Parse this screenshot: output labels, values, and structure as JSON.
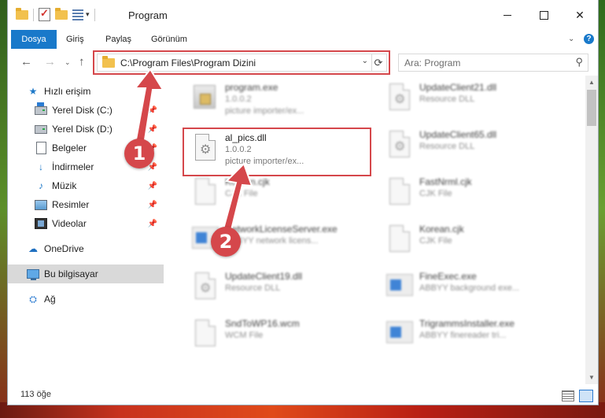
{
  "window": {
    "title": "Program",
    "controls": {
      "minimize": "—",
      "maximize": "☐",
      "close": "✕"
    }
  },
  "ribbon": {
    "tabs": [
      "Dosya",
      "Giriş",
      "Paylaş",
      "Görünüm"
    ],
    "chevron": "⌄",
    "help": "?"
  },
  "navigation": {
    "back": "←",
    "forward": "→",
    "recent": "⌄",
    "up": "↑",
    "address": "C:\\Program Files\\Program Dizini",
    "address_dropdown": "⌄",
    "refresh": "⟳",
    "search_placeholder": "Ara: Program",
    "search_icon": "search-icon"
  },
  "sidebar": {
    "items": [
      {
        "label": "Hızlı erişim",
        "icon": "star-icon",
        "pinned": false
      },
      {
        "label": "Yerel Disk (C:)",
        "icon": "drive-windows-icon",
        "pinned": true
      },
      {
        "label": "Yerel Disk (D:)",
        "icon": "drive-icon",
        "pinned": true
      },
      {
        "label": "Belgeler",
        "icon": "documents-icon",
        "pinned": true
      },
      {
        "label": "İndirmeler",
        "icon": "download-icon",
        "pinned": true
      },
      {
        "label": "Müzik",
        "icon": "music-icon",
        "pinned": true
      },
      {
        "label": "Resimler",
        "icon": "pictures-icon",
        "pinned": true
      },
      {
        "label": "Videolar",
        "icon": "videos-icon",
        "pinned": true
      },
      {
        "label": "OneDrive",
        "icon": "onedrive-icon",
        "pinned": false
      },
      {
        "label": "Bu bilgisayar",
        "icon": "this-pc-icon",
        "pinned": false,
        "selected": true
      },
      {
        "label": "Ağ",
        "icon": "network-icon",
        "pinned": false
      }
    ]
  },
  "files": [
    {
      "name": "program.exe",
      "line2": "1.0.0.2",
      "line3": "picture importer/ex...",
      "icon": "exe-icon",
      "blurred": true
    },
    {
      "name": "UpdateClient21.dll",
      "line2": "Resource DLL",
      "line3": "",
      "icon": "dll-icon",
      "blurred": true
    },
    {
      "name": "al_pics.dll",
      "line2": "1.0.0.2",
      "line3": "picture importer/ex...",
      "icon": "dll-icon",
      "blurred": false
    },
    {
      "name": "UpdateClient65.dll",
      "line2": "Resource DLL",
      "line3": "",
      "icon": "dll-icon",
      "blurred": true
    },
    {
      "name": "Korean.cjk",
      "line2": "CJK File",
      "line3": "",
      "icon": "file-icon",
      "blurred": true
    },
    {
      "name": "FastNrml.cjk",
      "line2": "CJK File",
      "line3": "",
      "icon": "file-icon",
      "blurred": true
    },
    {
      "name": "NetworkLicenseServer.exe",
      "line2": "ABBYY network licens...",
      "line3": "",
      "icon": "app-icon",
      "blurred": true
    },
    {
      "name": "Korean.cjk",
      "line2": "CJK File",
      "line3": "",
      "icon": "file-icon",
      "blurred": true
    },
    {
      "name": "UpdateClient19.dll",
      "line2": "Resource DLL",
      "line3": "",
      "icon": "dll-icon",
      "blurred": true
    },
    {
      "name": "FineExec.exe",
      "line2": "ABBYY background exe...",
      "line3": "",
      "icon": "app-icon",
      "blurred": true
    },
    {
      "name": "SndToWP16.wcm",
      "line2": "WCM File",
      "line3": "",
      "icon": "file-icon",
      "blurred": true
    },
    {
      "name": "TrigrammsInstaller.exe",
      "line2": "ABBYY finereader tri...",
      "line3": "",
      "icon": "app-icon",
      "blurred": true
    }
  ],
  "status": {
    "item_count": "113 öğe"
  },
  "annotations": {
    "badge_1": "1",
    "badge_2": "2",
    "color": "#d5474b"
  },
  "colors": {
    "file_tab": "#1979ca",
    "selection": "#d9d9d9",
    "annotation": "#d5474b"
  }
}
